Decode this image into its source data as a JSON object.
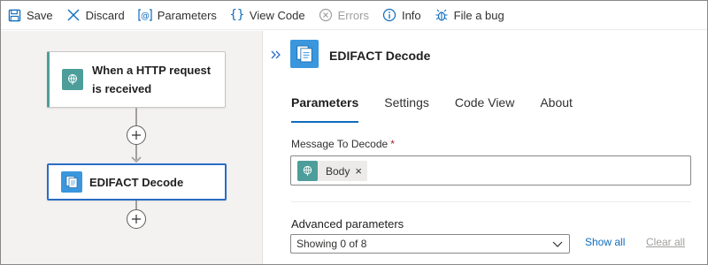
{
  "toolbar": {
    "save_label": "Save",
    "discard_label": "Discard",
    "parameters_label": "Parameters",
    "view_code_label": "View Code",
    "errors_label": "Errors",
    "info_label": "Info",
    "file_bug_label": "File a bug"
  },
  "designer": {
    "trigger_card": {
      "title_line1": "When a HTTP request",
      "title_line2": "is received",
      "icon": "request-globe-icon"
    },
    "action_card": {
      "title": "EDIFACT Decode",
      "icon": "edifact-document-icon"
    }
  },
  "panel": {
    "title": "EDIFACT Decode",
    "tabs": [
      {
        "label": "Parameters",
        "active": true
      },
      {
        "label": "Settings",
        "active": false
      },
      {
        "label": "Code View",
        "active": false
      },
      {
        "label": "About",
        "active": false
      }
    ],
    "message_field": {
      "label": "Message To Decode",
      "required_mark": "*",
      "token_label": "Body"
    },
    "advanced": {
      "label": "Advanced parameters",
      "select_value": "Showing 0 of 8",
      "show_all_label": "Show all",
      "clear_all_label": "Clear all"
    }
  },
  "colors": {
    "accent": "#0f6cbd",
    "trigger_teal": "#4d9e9a",
    "selected_border": "#2b6cc4",
    "edifact_blue": "#3a96dd",
    "canvas_bg": "#f3f2f1"
  }
}
